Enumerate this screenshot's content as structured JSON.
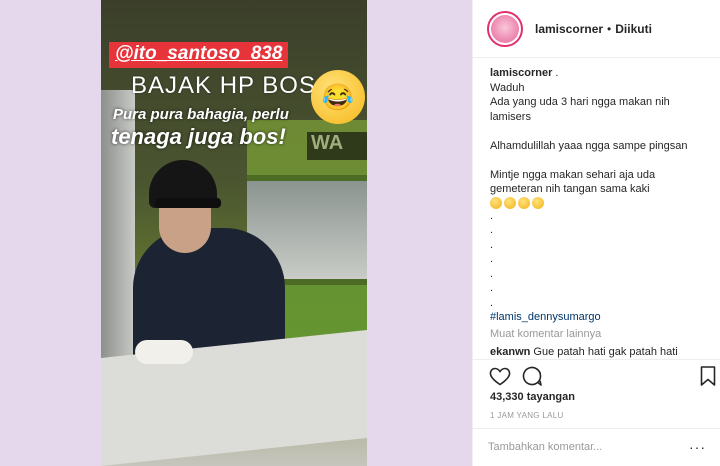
{
  "story": {
    "tag": "@ito_santoso_838",
    "headline": "BAJAK HP BOS",
    "caption_line1": "Pura pura bahagia, perlu",
    "caption_line2": "tenaga juga bos!",
    "wall_text": "WA"
  },
  "header": {
    "username": "lamiscorner",
    "separator": "•",
    "follow_label": "Diikuti"
  },
  "post": {
    "author": "lamiscorner",
    "author_suffix": " .",
    "lines": [
      "Waduh",
      "Ada yang uda 3 hari ngga makan nih",
      "lamisers",
      "",
      "Alhamdulillah yaaa ngga sampe pingsan",
      "",
      "Mintje ngga makan sehari aja uda",
      "gemeteran nih tangan sama kaki"
    ],
    "dots": [
      ".",
      ".",
      ".",
      ".",
      ".",
      ".",
      "."
    ],
    "hashtag": "#lamis_dennysumargo",
    "more_comments": "Muat komentar lainnya",
    "comment_user": "ekanwn",
    "comment_text": "Gue patah hati gak patah hati"
  },
  "stats": {
    "views": "43,330 tayangan",
    "time": "1 JAM YANG LALU"
  },
  "comment_input": {
    "placeholder": "Tambahkan komentar...",
    "options": "···"
  },
  "colors": {
    "tag_bg": "#e7343b",
    "hashtag": "#003569",
    "muted": "#999999",
    "background": "#e5d7ec"
  }
}
